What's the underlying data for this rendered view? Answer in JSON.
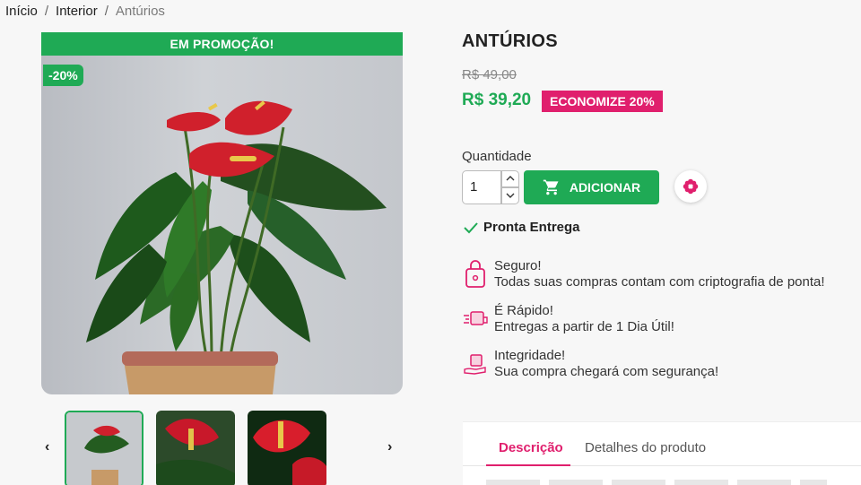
{
  "breadcrumb": {
    "items": [
      "Início",
      "Interior",
      "Antúrios"
    ],
    "sep": "/"
  },
  "product": {
    "promo_banner": "EM PROMOÇÃO!",
    "discount_tag": "-20%",
    "title": "ANTÚRIOS",
    "old_price": "R$ 49,00",
    "new_price": "R$ 39,20",
    "save_badge": "ECONOMIZE 20%"
  },
  "purchase": {
    "quantity_label": "Quantidade",
    "quantity_value": "1",
    "add_label": "ADICIONAR",
    "stock_label": "Pronta Entrega"
  },
  "features": [
    {
      "title": "Seguro!",
      "text": "Todas suas compras contam com criptografia de ponta!"
    },
    {
      "title": "É Rápido!",
      "text": "Entregas a partir de 1 Dia Útil!"
    },
    {
      "title": "Integridade!",
      "text": "Sua compra chegará com segurança!"
    }
  ],
  "tabs": [
    {
      "label": "Descrição"
    },
    {
      "label": "Detalhes do produto"
    }
  ],
  "nav": {
    "prev": "‹",
    "next": "›"
  },
  "colors": {
    "accent_green": "#1faa55",
    "accent_pink": "#e01f6d"
  }
}
